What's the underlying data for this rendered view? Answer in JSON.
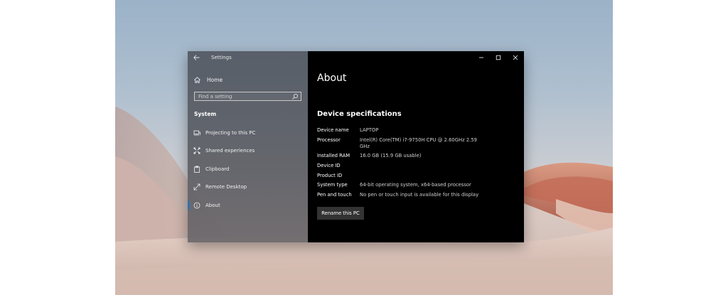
{
  "window": {
    "app_title": "Settings"
  },
  "nav": {
    "home_label": "Home",
    "search_placeholder": "Find a setting",
    "section_label": "System",
    "items": [
      {
        "label": "Projecting to this PC",
        "icon": "projecting-icon",
        "selected": false
      },
      {
        "label": "Shared experiences",
        "icon": "shared-experiences-icon",
        "selected": false
      },
      {
        "label": "Clipboard",
        "icon": "clipboard-icon",
        "selected": false
      },
      {
        "label": "Remote Desktop",
        "icon": "remote-desktop-icon",
        "selected": false
      },
      {
        "label": "About",
        "icon": "info-icon",
        "selected": true
      }
    ]
  },
  "main": {
    "title": "About",
    "specs_heading": "Device specifications",
    "specs": [
      {
        "label": "Device name",
        "value": "LAPTOP"
      },
      {
        "label": "Processor",
        "value": "Intel(R) Core(TM) i7-9750H CPU @ 2.60GHz   2.59 GHz"
      },
      {
        "label": "Installed RAM",
        "value": "16.0 GB (15.9 GB usable)"
      },
      {
        "label": "Device ID",
        "value": ""
      },
      {
        "label": "Product ID",
        "value": ""
      },
      {
        "label": "System type",
        "value": "64-bit operating system, x64-based processor"
      },
      {
        "label": "Pen and touch",
        "value": "No pen or touch input is available for this display"
      }
    ],
    "rename_button": "Rename this PC"
  },
  "colors": {
    "accent": "#0078d7",
    "content_background": "#000000",
    "button_background": "#333333"
  }
}
